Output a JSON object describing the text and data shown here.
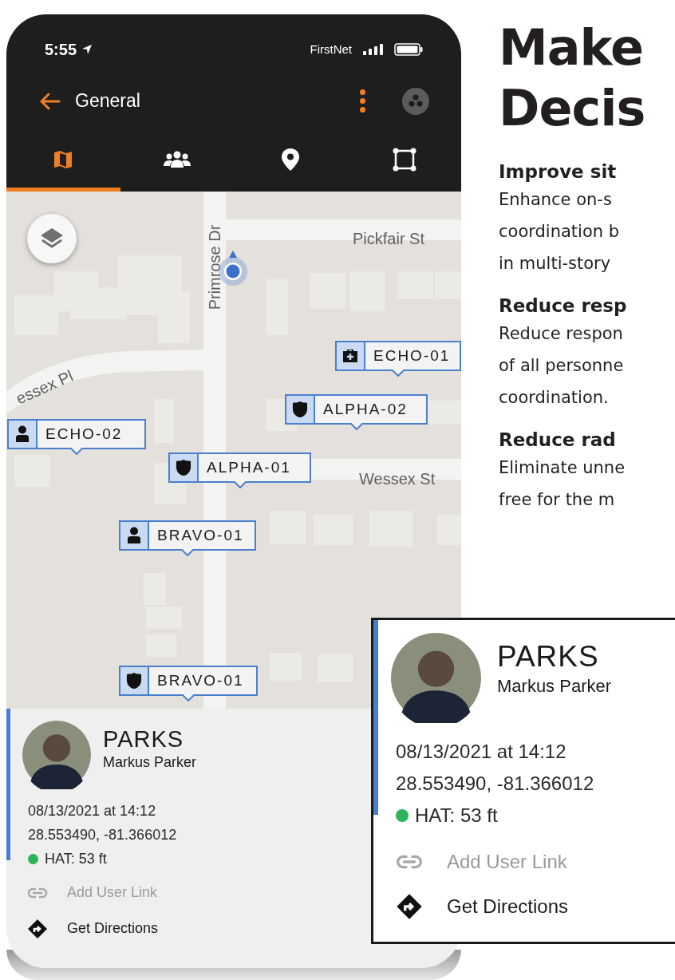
{
  "status_bar": {
    "time": "5:55",
    "carrier": "FirstNet"
  },
  "toolbar": {
    "title": "General"
  },
  "tabs": [
    {
      "kind": "map",
      "selected": true
    },
    {
      "kind": "team",
      "selected": false
    },
    {
      "kind": "pin",
      "selected": false
    },
    {
      "kind": "area",
      "selected": false
    }
  ],
  "map": {
    "street_labels": [
      {
        "text": "Pickfair St",
        "kind": "horizontal"
      },
      {
        "text": "Primrose Dr",
        "kind": "vertical"
      },
      {
        "text": "essex Pl",
        "kind": "slanted"
      },
      {
        "text": "Wessex St",
        "kind": "horizontal"
      }
    ],
    "markers": [
      {
        "label": "ECHO-01",
        "kind": "medical"
      },
      {
        "label": "ALPHA-02",
        "kind": "badge"
      },
      {
        "label": "ECHO-02",
        "kind": "person"
      },
      {
        "label": "ALPHA-01",
        "kind": "badge"
      },
      {
        "label": "BRAVO-01",
        "kind": "person"
      },
      {
        "label": "BRAVO-01",
        "kind": "badge"
      }
    ]
  },
  "user_card": {
    "callsign": "PARKS",
    "name": "Markus Parker",
    "timestamp": "08/13/2021 at 14:12",
    "coordinates": "28.553490, -81.366012",
    "hat": "HAT: 53 ft",
    "actions": [
      {
        "kind": "link",
        "label": "Add User Link",
        "disabled": true
      },
      {
        "kind": "directions",
        "label": "Get Directions",
        "disabled": false
      }
    ]
  },
  "article": {
    "headline": [
      "Make",
      "Decis"
    ],
    "sections": [
      {
        "heading": "Improve sit",
        "lines": [
          "Enhance on-s",
          "coordination b",
          "in multi-story"
        ]
      },
      {
        "heading": "Reduce resp",
        "lines": [
          "Reduce respon",
          "of all personne",
          "coordination."
        ]
      },
      {
        "heading": "Reduce rad",
        "lines": [
          "Eliminate unne",
          "free for the m"
        ]
      }
    ]
  },
  "callout": {
    "callsign": "PARKS",
    "name": "Markus Parker",
    "timestamp": "08/13/2021 at 14:12",
    "coordinates": "28.553490, -81.366012",
    "hat": "HAT: 53 ft",
    "actions": [
      {
        "kind": "link",
        "label": "Add User Link",
        "disabled": true
      },
      {
        "kind": "directions",
        "label": "Get Directions",
        "disabled": false
      }
    ]
  }
}
